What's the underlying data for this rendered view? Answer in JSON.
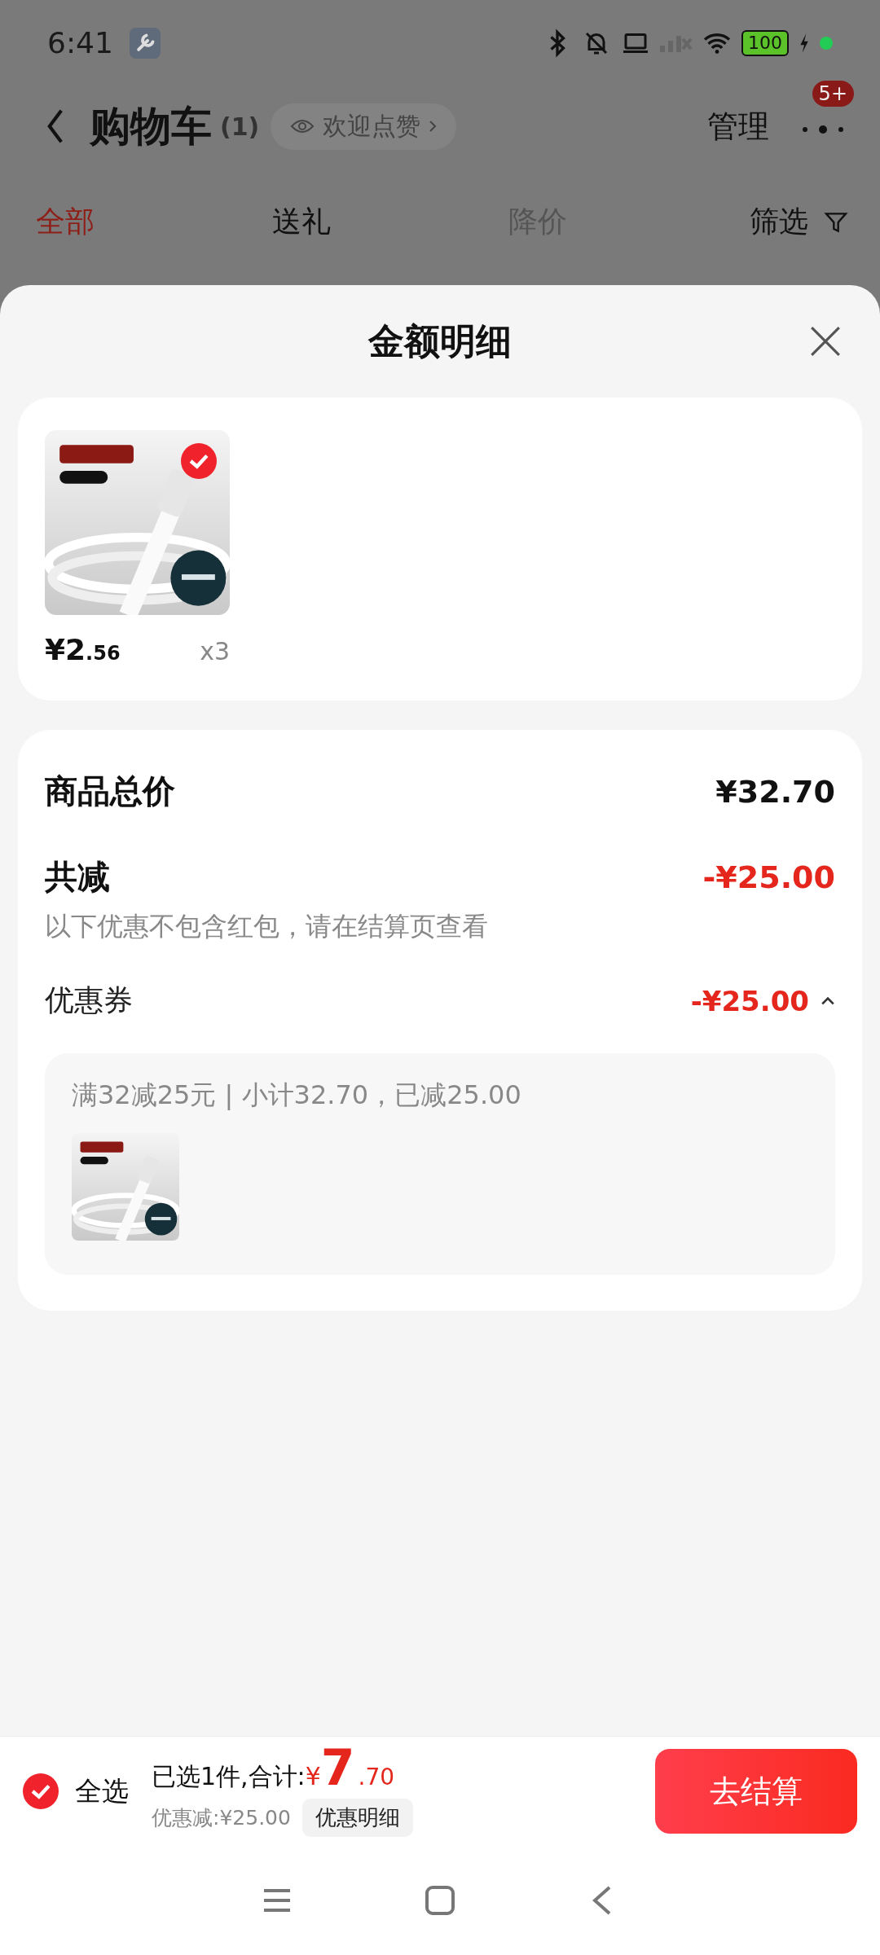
{
  "status_bar": {
    "time": "6:41",
    "battery": "100"
  },
  "header": {
    "title": "购物车",
    "count": "(1)",
    "like_chip": "欢迎点赞",
    "manage": "管理",
    "badge": "5+"
  },
  "tabs": [
    {
      "label": "全部",
      "selected": true,
      "disabled": false
    },
    {
      "label": "送礼",
      "selected": false,
      "disabled": false
    },
    {
      "label": "降价",
      "selected": false,
      "disabled": true
    }
  ],
  "filter": {
    "label": "筛选"
  },
  "sheet": {
    "title": "金额明细",
    "items": [
      {
        "kind": "picture",
        "selected": true,
        "price_main": "¥2",
        "price_decimal": ".56",
        "quantity": "x3"
      }
    ],
    "summary": {
      "total_label": "商品总价",
      "total_value": "¥32.70",
      "discount_label": "共减",
      "discount_value": "-¥25.00",
      "note": "以下优惠不包含红包，请在结算页查看",
      "coupon_label": "优惠券",
      "coupon_value": "-¥25.00",
      "expanded": true,
      "coupon_detail": "满32减25元 | 小计32.70，已减25.00"
    }
  },
  "bottom_bar": {
    "select_all": {
      "label": "全选",
      "checked": true
    },
    "summary_prefix": "已选1件,合计:",
    "total_currency": "¥",
    "total_integer": "7",
    "total_decimal": ".70",
    "discount_text": "优惠减:¥25.00",
    "details_button": "优惠明细",
    "checkout_button": "去结算"
  }
}
